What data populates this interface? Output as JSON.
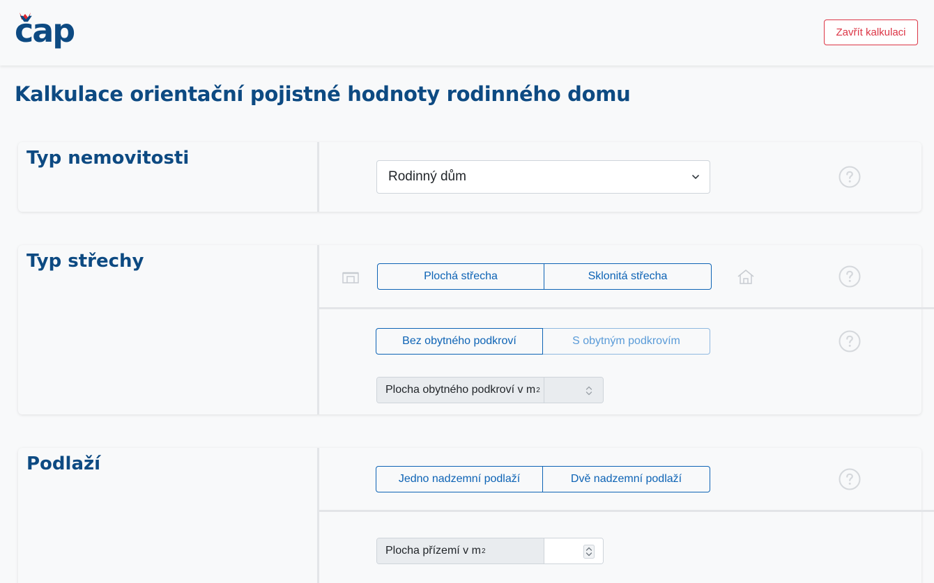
{
  "header": {
    "logo_text": "čap",
    "close_label": "Zavřít kalkulaci"
  },
  "page": {
    "title": "Kalkulace orientační pojistné hodnoty rodinného domu"
  },
  "sections": {
    "property_type": {
      "title": "Typ nemovitosti",
      "select_value": "Rodinný dům"
    },
    "roof_type": {
      "title": "Typ střechy",
      "options": [
        "Plochá střecha",
        "Sklonitá střecha"
      ],
      "attic_options": [
        "Bez obytného podkroví",
        "S obytným podkrovím"
      ],
      "attic_area_label": "Plocha obytného podkroví v m",
      "attic_area_unit_sup": "2"
    },
    "floors": {
      "title": "Podlaží",
      "options": [
        "Jedno nadzemní podlaží",
        "Dvě nadzemní podlaží"
      ],
      "ground_area_label": "Plocha přízemí v m",
      "ground_area_unit_sup": "2"
    }
  },
  "colors": {
    "brand_blue": "#0d4a82",
    "link_blue": "#0d63b5",
    "danger": "#dc3545",
    "logo_flame": "#e0262e"
  },
  "icons": {
    "help": "question-circle-icon",
    "flat_roof": "flat-roof-house-icon",
    "pitched_roof": "pitched-roof-house-icon",
    "select_caret": "chevron-down-icon",
    "number_spinner": "spinner-arrows-icon"
  }
}
